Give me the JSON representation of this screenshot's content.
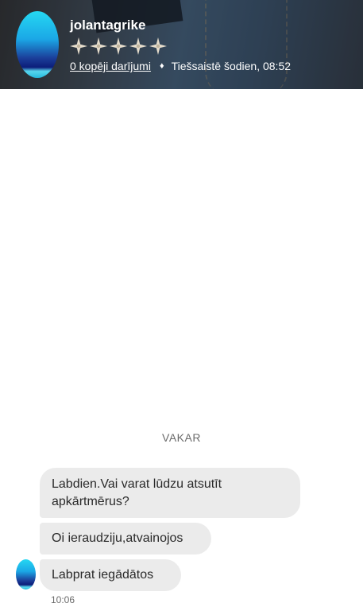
{
  "header": {
    "username": "jolantagrike",
    "rating_stars": 5,
    "deals_link": "0 kopēji darījumi",
    "separator": "♦",
    "status": "Tiešsaistē šodien, 08:52"
  },
  "conversation": {
    "day_separator": "VAKAR",
    "messages": [
      {
        "text": "Labdien.Vai varat lūdzu atsutīt apkārtmērus?"
      },
      {
        "text": "Oi ieraudziju,atvainojos"
      },
      {
        "text": "Labprat iegādātos"
      }
    ],
    "last_time": "10:06"
  },
  "icons": {
    "star": "star-icon",
    "avatar": "user-avatar"
  }
}
